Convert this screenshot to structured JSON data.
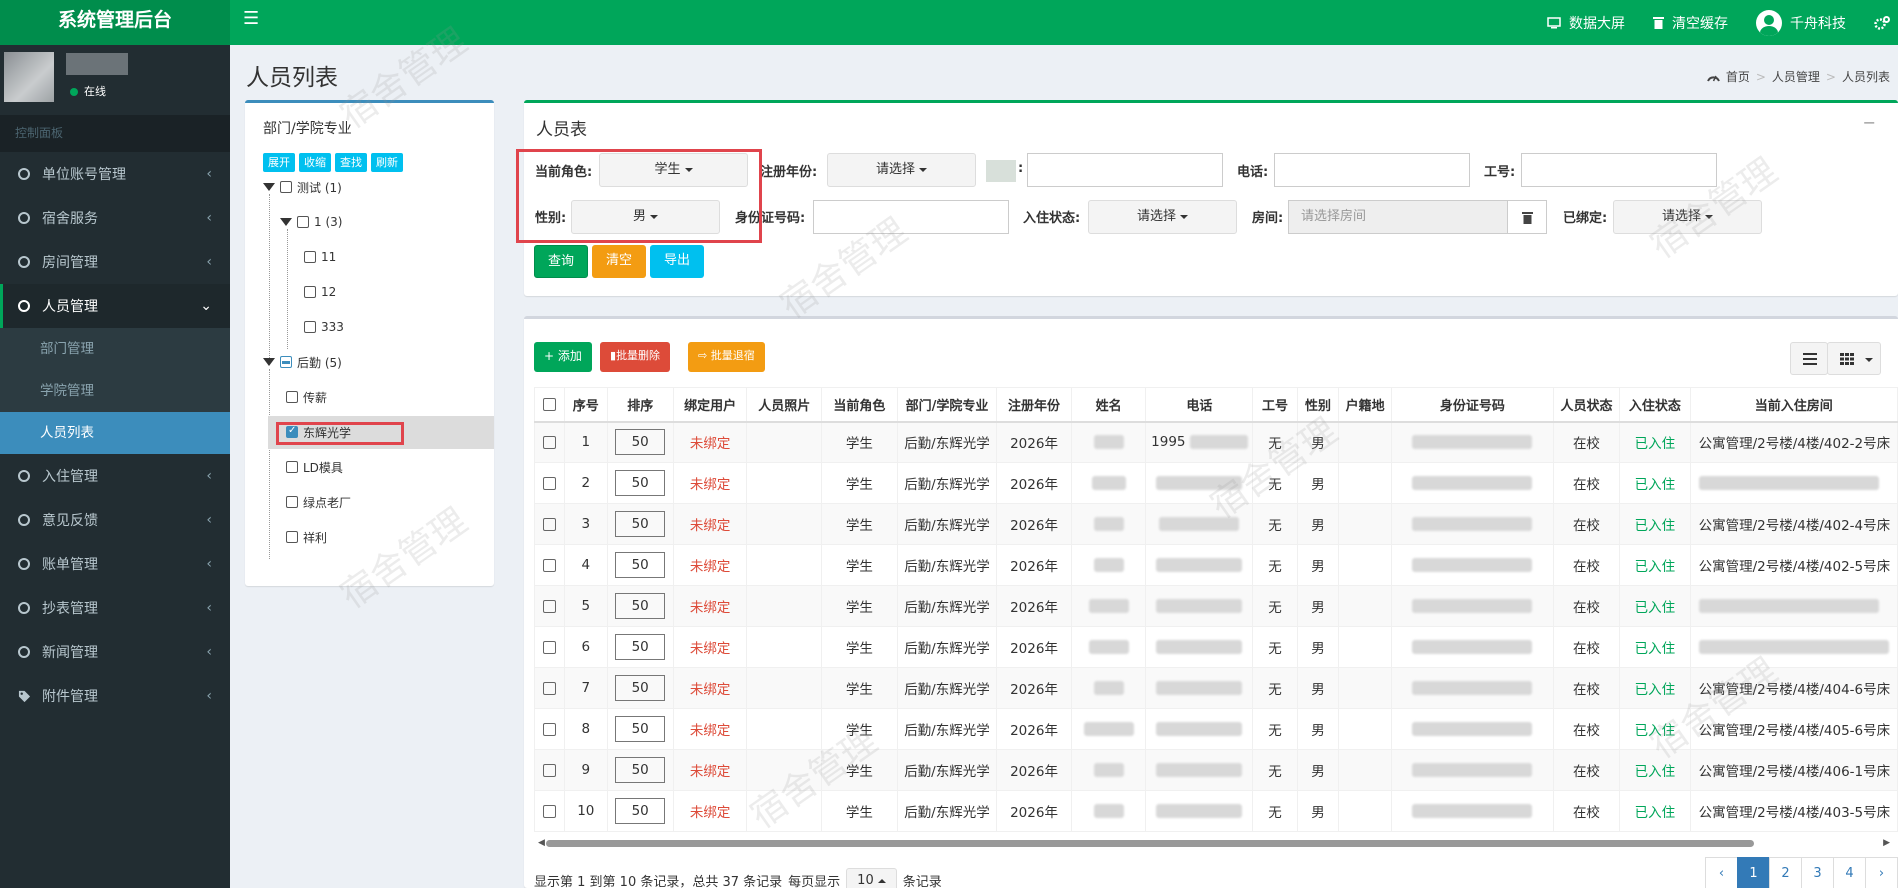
{
  "app": {
    "title": "系统管理后台"
  },
  "header": {
    "dashboard": "数据大屏",
    "clear_cache": "清空缓存",
    "company": "千舟科技"
  },
  "user": {
    "status": "在线"
  },
  "sidebar": {
    "section": "控制面板",
    "items": [
      {
        "label": "单位账号管理"
      },
      {
        "label": "宿舍服务"
      },
      {
        "label": "房间管理"
      },
      {
        "label": "人员管理"
      },
      {
        "label": "入住管理"
      },
      {
        "label": "意见反馈"
      },
      {
        "label": "账单管理"
      },
      {
        "label": "抄表管理"
      },
      {
        "label": "新闻管理"
      },
      {
        "label": "附件管理"
      }
    ],
    "submenu": [
      {
        "label": "部门管理"
      },
      {
        "label": "学院管理"
      },
      {
        "label": "人员列表"
      }
    ]
  },
  "page": {
    "title": "人员列表"
  },
  "breadcrumb": {
    "home": "首页",
    "level1": "人员管理",
    "level2": "人员列表"
  },
  "tree": {
    "title": "部门/学院专业",
    "buttons": {
      "expand": "展开",
      "collapse": "收缩",
      "find": "查找",
      "refresh": "刷新"
    },
    "nodes": {
      "test": "测试 (1)",
      "one": "1 (3)",
      "n11": "11",
      "n12": "12",
      "n333": "333",
      "logistics": "后勤 (5)",
      "chuanxin": "传薪",
      "donghui": "东辉光学",
      "ld": "LD模具",
      "lvdian": "绿点老厂",
      "xiangli": "祥利"
    }
  },
  "filter": {
    "title": "人员表",
    "labels": {
      "role": "当前角色:",
      "reg_year": "注册年份:",
      "phone": "电话:",
      "job_no": "工号:",
      "gender": "性别:",
      "id_no": "身份证号码:",
      "checkin": "入住状态:",
      "room": "房间:",
      "bound": "已绑定:",
      "colon": ":"
    },
    "values": {
      "role": "学生",
      "reg_year": "请选择",
      "gender": "男",
      "checkin": "请选择",
      "bound": "请选择"
    },
    "room_placeholder": "请选择房间",
    "buttons": {
      "search": "查询",
      "clear": "清空",
      "export": "导出"
    }
  },
  "toolbar": {
    "add": "+ 添加",
    "batch_delete": "批量删除",
    "batch_checkout": "批量退宿"
  },
  "table": {
    "headers": [
      "序号",
      "排序",
      "绑定用户",
      "人员照片",
      "当前角色",
      "部门/学院专业",
      "注册年份",
      "姓名",
      "电话",
      "工号",
      "性别",
      "户籍地",
      "身份证号码",
      "人员状态",
      "入住状态",
      "当前入住房间"
    ],
    "rows": [
      {
        "no": "1",
        "sort": "50",
        "bind": "未绑定",
        "role": "学生",
        "dept": "后勤/东辉光学",
        "year": "2026年",
        "phone": "1995",
        "job": "无",
        "gender": "男",
        "status": "在校",
        "checkin": "已入住",
        "room": "公寓管理/2号楼/4楼/402-2号床"
      },
      {
        "no": "2",
        "sort": "50",
        "bind": "未绑定",
        "role": "学生",
        "dept": "后勤/东辉光学",
        "year": "2026年",
        "phone": "",
        "job": "无",
        "gender": "男",
        "status": "在校",
        "checkin": "已入住",
        "room": ""
      },
      {
        "no": "3",
        "sort": "50",
        "bind": "未绑定",
        "role": "学生",
        "dept": "后勤/东辉光学",
        "year": "2026年",
        "phone": "",
        "job": "无",
        "gender": "男",
        "status": "在校",
        "checkin": "已入住",
        "room": "公寓管理/2号楼/4楼/402-4号床"
      },
      {
        "no": "4",
        "sort": "50",
        "bind": "未绑定",
        "role": "学生",
        "dept": "后勤/东辉光学",
        "year": "2026年",
        "phone": "",
        "job": "无",
        "gender": "男",
        "status": "在校",
        "checkin": "已入住",
        "room": "公寓管理/2号楼/4楼/402-5号床"
      },
      {
        "no": "5",
        "sort": "50",
        "bind": "未绑定",
        "role": "学生",
        "dept": "后勤/东辉光学",
        "year": "2026年",
        "phone": "",
        "job": "无",
        "gender": "男",
        "status": "在校",
        "checkin": "已入住",
        "room": ""
      },
      {
        "no": "6",
        "sort": "50",
        "bind": "未绑定",
        "role": "学生",
        "dept": "后勤/东辉光学",
        "year": "2026年",
        "phone": "",
        "job": "无",
        "gender": "男",
        "status": "在校",
        "checkin": "已入住",
        "room": ""
      },
      {
        "no": "7",
        "sort": "50",
        "bind": "未绑定",
        "role": "学生",
        "dept": "后勤/东辉光学",
        "year": "2026年",
        "phone": "",
        "job": "无",
        "gender": "男",
        "status": "在校",
        "checkin": "已入住",
        "room": "公寓管理/2号楼/4楼/404-6号床"
      },
      {
        "no": "8",
        "sort": "50",
        "bind": "未绑定",
        "role": "学生",
        "dept": "后勤/东辉光学",
        "year": "2026年",
        "phone": "",
        "job": "无",
        "gender": "男",
        "status": "在校",
        "checkin": "已入住",
        "room": "公寓管理/2号楼/4楼/405-6号床"
      },
      {
        "no": "9",
        "sort": "50",
        "bind": "未绑定",
        "role": "学生",
        "dept": "后勤/东辉光学",
        "year": "2026年",
        "phone": "",
        "job": "无",
        "gender": "男",
        "status": "在校",
        "checkin": "已入住",
        "room": "公寓管理/2号楼/4楼/406-1号床"
      },
      {
        "no": "10",
        "sort": "50",
        "bind": "未绑定",
        "role": "学生",
        "dept": "后勤/东辉光学",
        "year": "2026年",
        "phone": "",
        "job": "无",
        "gender": "男",
        "status": "在校",
        "checkin": "已入住",
        "room": "公寓管理/2号楼/4楼/403-5号床"
      }
    ]
  },
  "footer": {
    "info": "显示第 1 到第 10 条记录，总共 37 条记录",
    "per_page": "每页显示",
    "page_size": "10",
    "records": "条记录"
  },
  "pagination": {
    "prev": "‹",
    "pages": [
      "1",
      "2",
      "3",
      "4"
    ],
    "next": "›"
  },
  "watermark": "宿舍管理"
}
